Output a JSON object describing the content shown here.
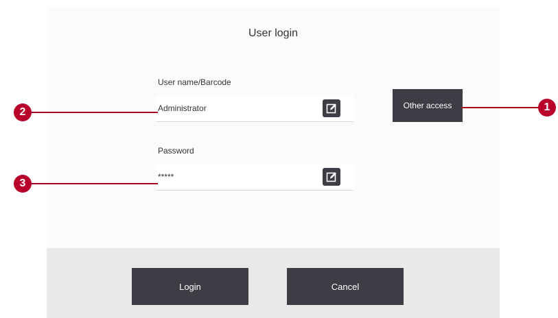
{
  "dialog": {
    "title": "User login"
  },
  "username_field": {
    "label": "User name/Barcode",
    "value": "Administrator"
  },
  "password_field": {
    "label": "Password",
    "value": "*****"
  },
  "other_access_button": {
    "label": "Other access"
  },
  "footer": {
    "login_label": "Login",
    "cancel_label": "Cancel"
  },
  "callouts": {
    "one": "1",
    "two": "2",
    "three": "3"
  },
  "colors": {
    "button_dark": "#3c3d45",
    "callout_red": "#b8002a",
    "footer_bg": "#e9e9e9"
  }
}
